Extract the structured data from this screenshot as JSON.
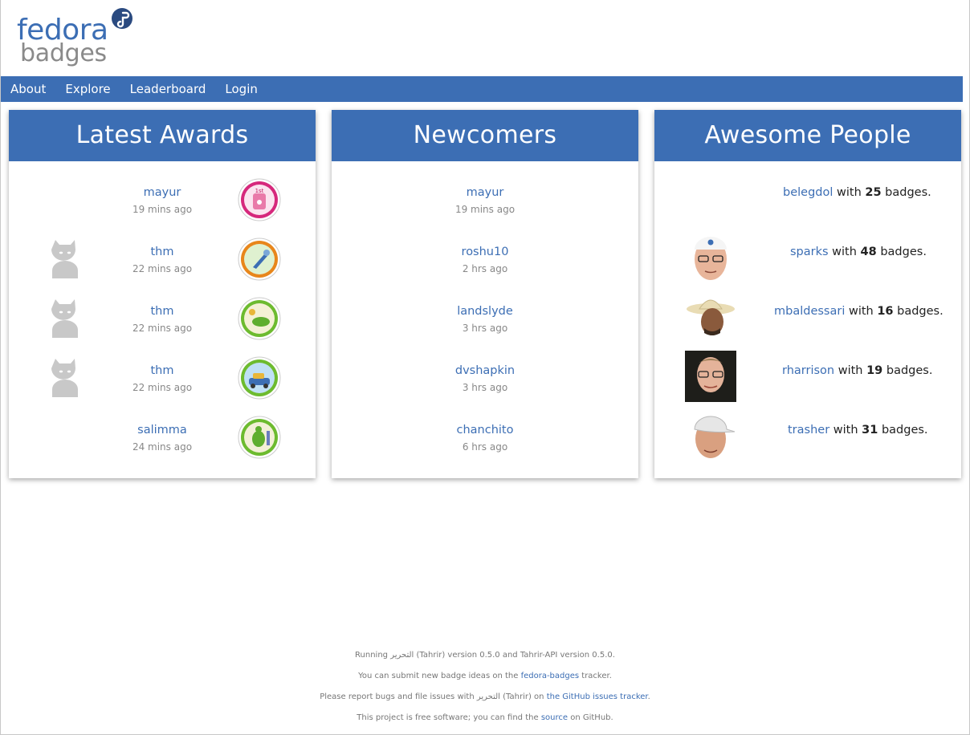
{
  "logo": {
    "line1": "fedora",
    "line2": "badges"
  },
  "nav": {
    "items": [
      "About",
      "Explore",
      "Leaderboard",
      "Login"
    ]
  },
  "latest_awards": {
    "title": "Latest Awards",
    "rows": [
      {
        "user": "mayur",
        "time": "19 mins ago",
        "has_avatar": false,
        "badge_color": "#d6287c",
        "badge_icon": "first-place-badge-icon"
      },
      {
        "user": "thm",
        "time": "22 mins ago",
        "has_avatar": true,
        "badge_color": "#e8861b",
        "badge_icon": "wrench-badge-icon"
      },
      {
        "user": "thm",
        "time": "22 mins ago",
        "has_avatar": true,
        "badge_color": "#6dbb2f",
        "badge_icon": "dragon-badge-icon"
      },
      {
        "user": "thm",
        "time": "22 mins ago",
        "has_avatar": true,
        "badge_color": "#6dbb2f",
        "badge_icon": "car-badge-icon"
      },
      {
        "user": "salimma",
        "time": "24 mins ago",
        "has_avatar": false,
        "badge_color": "#6dbb2f",
        "badge_icon": "turtle-badge-icon"
      }
    ]
  },
  "newcomers": {
    "title": "Newcomers",
    "rows": [
      {
        "user": "mayur",
        "time": "19 mins ago"
      },
      {
        "user": "roshu10",
        "time": "2 hrs ago"
      },
      {
        "user": "landslyde",
        "time": "3 hrs ago"
      },
      {
        "user": "dvshapkin",
        "time": "3 hrs ago"
      },
      {
        "user": "chanchito",
        "time": "6 hrs ago"
      }
    ]
  },
  "awesome_people": {
    "title": "Awesome People",
    "with_text": "with",
    "badges_text": "badges.",
    "rows": [
      {
        "user": "belegdol",
        "count": "25",
        "has_photo": false
      },
      {
        "user": "sparks",
        "count": "48",
        "has_photo": true
      },
      {
        "user": "mbaldessari",
        "count": "16",
        "has_photo": true
      },
      {
        "user": "rharrison",
        "count": "19",
        "has_photo": true
      },
      {
        "user": "trasher",
        "count": "31",
        "has_photo": true
      }
    ]
  },
  "footer": {
    "l1": "Running التحرير (Tahrir) version 0.5.0 and Tahrir-API version 0.5.0.",
    "l2_pre": "You can submit new badge ideas on the ",
    "l2_link": "fedora-badges",
    "l2_post": " tracker.",
    "l3_pre": "Please report bugs and file issues with التحرير (Tahrir) on ",
    "l3_link": "the GitHub issues tracker",
    "l3_post": ".",
    "l4_pre": "This project is free software; you can find the ",
    "l4_link": "source",
    "l4_post": " on GitHub."
  },
  "colors": {
    "brand_blue": "#3c6eb4",
    "logo_grey": "#8a8a8a"
  }
}
